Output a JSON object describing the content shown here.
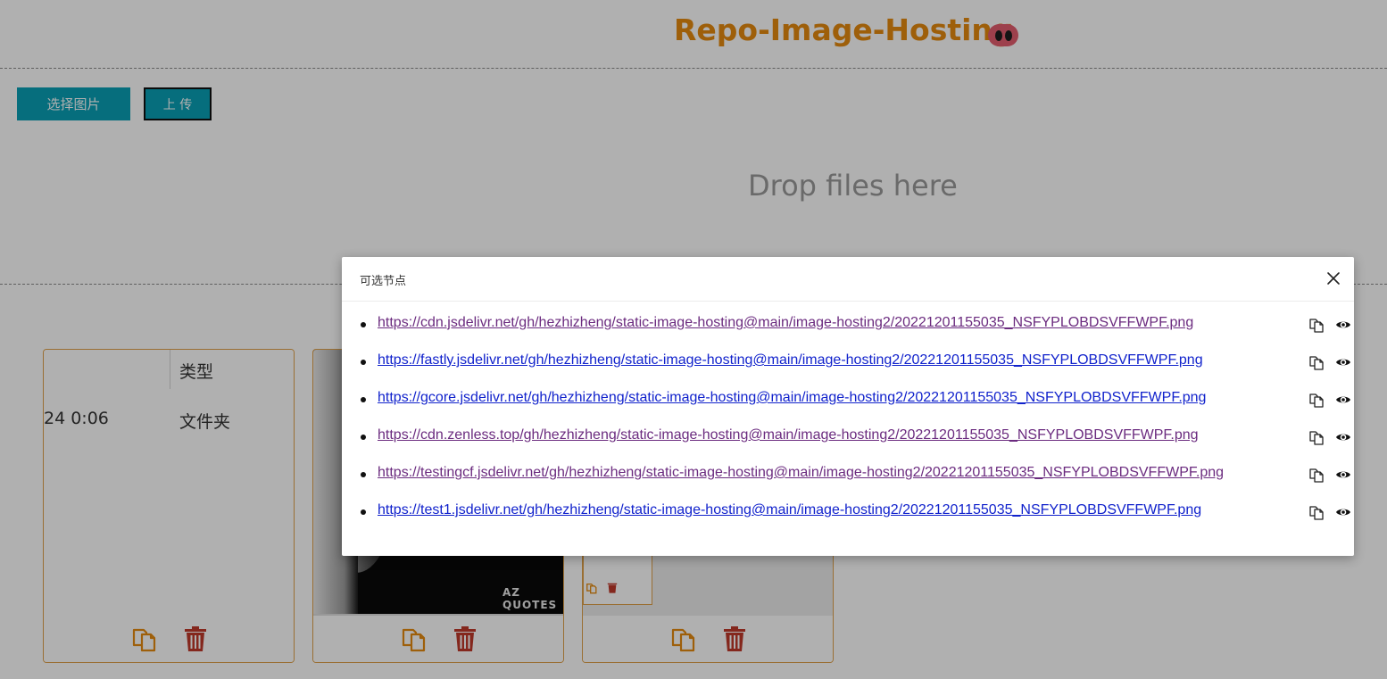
{
  "header": {
    "title": "Repo-Image-Hosting",
    "logo_icon": "pig-nose-icon"
  },
  "toolbar": {
    "select_label": "选择图片",
    "upload_label": "上 传"
  },
  "dropzone": {
    "text": "Drop files here"
  },
  "cards": [
    {
      "image_text": {
        "column_type": "类型",
        "date_fragment": "24 0:06",
        "folder_type": "文件夹"
      }
    },
    {
      "image_text": {
        "watermark": "AZ QUOTES"
      }
    },
    {
      "image_text": {}
    }
  ],
  "modal": {
    "title": "可选节点",
    "nodes": [
      {
        "url": "https://cdn.jsdelivr.net/gh/hezhizheng/static-image-hosting@main/image-hosting2/20221201155035_NSFYPLOBDSVFFWPF.png",
        "visited": true
      },
      {
        "url": "https://fastly.jsdelivr.net/gh/hezhizheng/static-image-hosting@main/image-hosting2/20221201155035_NSFYPLOBDSVFFWPF.png",
        "visited": false
      },
      {
        "url": "https://gcore.jsdelivr.net/gh/hezhizheng/static-image-hosting@main/image-hosting2/20221201155035_NSFYPLOBDSVFFWPF.png",
        "visited": false
      },
      {
        "url": "https://cdn.zenless.top/gh/hezhizheng/static-image-hosting@main/image-hosting2/20221201155035_NSFYPLOBDSVFFWPF.png",
        "visited": true
      },
      {
        "url": "https://testingcf.jsdelivr.net/gh/hezhizheng/static-image-hosting@main/image-hosting2/20221201155035_NSFYPLOBDSVFFWPF.png",
        "visited": true
      },
      {
        "url": "https://test1.jsdelivr.net/gh/hezhizheng/static-image-hosting@main/image-hosting2/20221201155035_NSFYPLOBDSVFFWPF.png",
        "visited": false
      }
    ]
  },
  "colors": {
    "accent": "#0aa0b5",
    "title": "#e58a0f",
    "copy_icon": "#e58a0f",
    "delete_icon": "#c0392b",
    "link_visited": "#6b2b7f",
    "link": "#1122cc"
  }
}
